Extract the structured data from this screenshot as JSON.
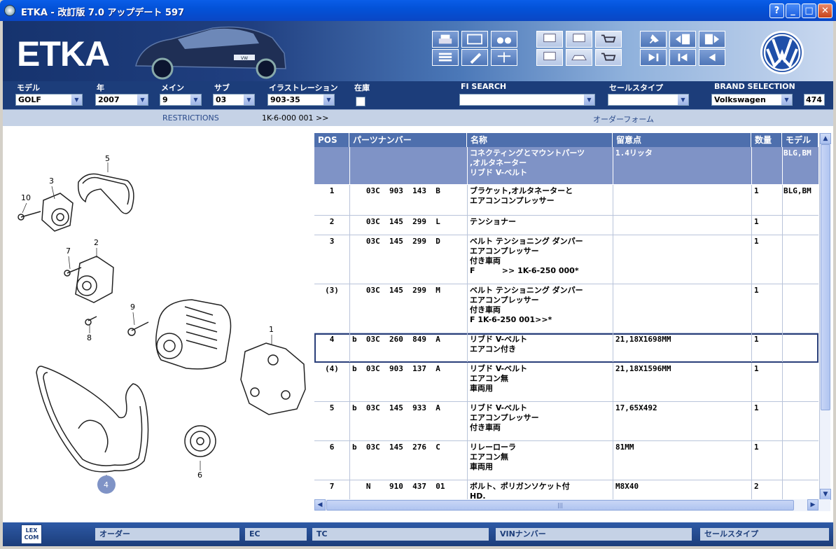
{
  "window": {
    "title": "ETKA - 改訂版 7.0 アップデート 597",
    "help_label": "?",
    "min_label": "_",
    "max_label": "□",
    "close_label": "✕"
  },
  "brand": {
    "logo_text": "ETKA",
    "plate": "VW"
  },
  "selection": {
    "model_label": "モデル",
    "model_value": "GOLF",
    "year_label": "年",
    "year_value": "2007",
    "main_label": "メイン",
    "main_value": "9",
    "sub_label": "サブ",
    "sub_value": "03",
    "illustration_label": "イラストレーション",
    "illustration_value": "903-35",
    "stock_label": "在庫",
    "fi_search_label": "FI SEARCH",
    "sales_type_label": "セールスタイプ",
    "brand_selection_label": "BRAND SELECTION",
    "brand_value": "Volkswagen",
    "count": "474"
  },
  "restrictions": {
    "label": "RESTRICTIONS",
    "range": "1K-6-000 001 >>",
    "order_form": "オーダーフォーム"
  },
  "drawing": {
    "callouts": [
      "5",
      "3",
      "10",
      "7",
      "2",
      "9",
      "8",
      "1",
      "4",
      "6"
    ]
  },
  "table": {
    "headers": [
      "POS",
      "パーツナンバー",
      "名称",
      "留意点",
      "数量",
      "モデル"
    ],
    "rows": [
      {
        "pos": "",
        "part": "",
        "name": "コネクティングとマウントパーツ\n,オルタネーター\nリブド V-ベルト",
        "note": "1.4リッタ",
        "qty": "",
        "model": "BLG,BM"
      },
      {
        "pos": "1",
        "part": "   03C  903  143  B",
        "name": "ブラケット,オルタネーターと\nエアコンコンプレッサー",
        "note": "",
        "qty": "1",
        "model": "BLG,BM"
      },
      {
        "pos": "2",
        "part": "   03C  145  299  L",
        "name": "テンショナー",
        "note": "",
        "qty": "1",
        "model": ""
      },
      {
        "pos": "3",
        "part": "   03C  145  299  D",
        "name": "ベルト テンショニング ダンパー\nエアコンプレッサー\n付き車両\nF          >> 1K-6-250 000*",
        "note": "",
        "qty": "1",
        "model": ""
      },
      {
        "pos": "(3)",
        "part": "   03C  145  299  M",
        "name": "ベルト テンショニング ダンパー\nエアコンプレッサー\n付き車両\nF 1K-6-250 001>>*",
        "note": "",
        "qty": "1",
        "model": ""
      },
      {
        "pos": "4",
        "part": "b  03C  260  849  A",
        "name": "リブド V-ベルト\nエアコン付き",
        "note": "21,18X1698MM",
        "qty": "1",
        "model": ""
      },
      {
        "pos": "(4)",
        "part": "b  03C  903  137  A",
        "name": "リブド V-ベルト\nエアコン無\n車両用",
        "note": "21,18X1596MM",
        "qty": "1",
        "model": ""
      },
      {
        "pos": "5",
        "part": "b  03C  145  933  A",
        "name": "リブド V-ベルト\nエアコンプレッサー\n付き車両",
        "note": "17,65X492",
        "qty": "1",
        "model": ""
      },
      {
        "pos": "6",
        "part": "b  03C  145  276  C",
        "name": "リレーローラ\nエアコン無\n車両用",
        "note": "81MM",
        "qty": "1",
        "model": ""
      },
      {
        "pos": "7",
        "part": "   N    910  437  01",
        "name": "ボルト、ポリガンソケット付\nHD.",
        "note": "M8X40",
        "qty": "2",
        "model": ""
      }
    ]
  },
  "bottom": {
    "lex_label": "LEX\nCOM",
    "order": "オーダー",
    "ec": "EC",
    "tc": "TC",
    "vin": "VINナンバー",
    "sales_type": "セールスタイプ"
  }
}
